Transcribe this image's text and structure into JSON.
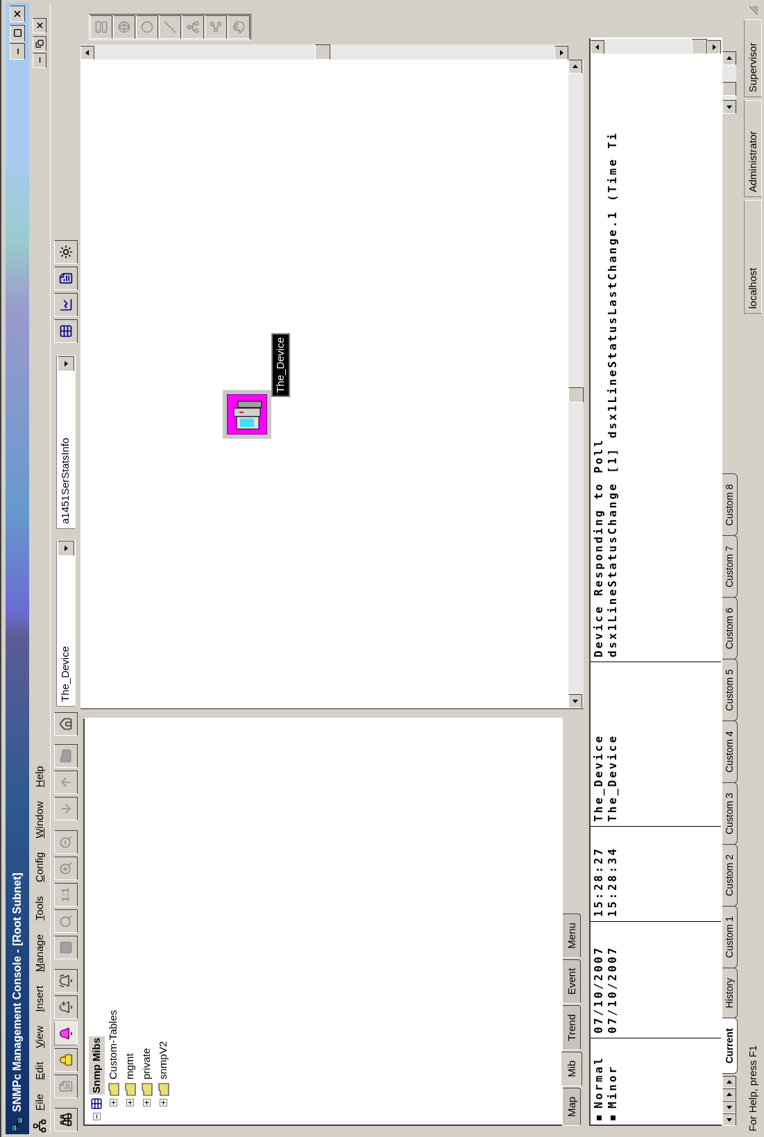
{
  "window": {
    "title": "SNMPc Management Console - [Root Subnet]"
  },
  "menu": [
    {
      "label": "File"
    },
    {
      "label": "Edit"
    },
    {
      "label": "View"
    },
    {
      "label": "Insert"
    },
    {
      "label": "Manage"
    },
    {
      "label": "Tools"
    },
    {
      "label": "Config"
    },
    {
      "label": "Window"
    },
    {
      "label": "Help"
    }
  ],
  "toolbar": {
    "zoom_label": "1:1",
    "device_combo": "The_Device",
    "mib_combo": "a1451SerStatsInfo"
  },
  "mib_tree": {
    "label": "Snmp Mibs",
    "selected": true,
    "expanded": true,
    "children": [
      {
        "label": "Custom-Tables",
        "expanded": false
      },
      {
        "label": "mgmt",
        "expanded": false
      },
      {
        "label": "private",
        "expanded": false
      },
      {
        "label": "snmpV2",
        "expanded": false
      }
    ]
  },
  "pane_tabs": [
    {
      "label": "Map",
      "selected": false
    },
    {
      "label": "Mib",
      "selected": true
    },
    {
      "label": "Trend",
      "selected": false
    },
    {
      "label": "Event",
      "selected": false
    },
    {
      "label": "Menu",
      "selected": false
    }
  ],
  "map": {
    "nodes": [
      {
        "label": "The_Device"
      }
    ]
  },
  "event_log": {
    "rows": [
      {
        "severity": "Normal",
        "date": "07/10/2007",
        "time": "15:28:27",
        "device": "The_Device",
        "message": "Device Responding to Poll"
      },
      {
        "severity": "Minor",
        "date": "07/10/2007",
        "time": "15:28:34",
        "device": "The_Device",
        "message": "dsx1LineStatusChange [1] dsx1LineStatusLastChange.1 (Time Ti"
      }
    ],
    "tabs": [
      {
        "label": "Current",
        "selected": true
      },
      {
        "label": "History",
        "selected": false
      },
      {
        "label": "Custom 1",
        "selected": false
      },
      {
        "label": "Custom 2",
        "selected": false
      },
      {
        "label": "Custom 3",
        "selected": false
      },
      {
        "label": "Custom 4",
        "selected": false
      },
      {
        "label": "Custom 5",
        "selected": false
      },
      {
        "label": "Custom 6",
        "selected": false
      },
      {
        "label": "Custom 7",
        "selected": false
      },
      {
        "label": "Custom 8",
        "selected": false
      }
    ]
  },
  "status_bar": {
    "help": "For Help, press F1",
    "panels": [
      "localhost",
      "Administrator",
      "Supervisor"
    ]
  }
}
